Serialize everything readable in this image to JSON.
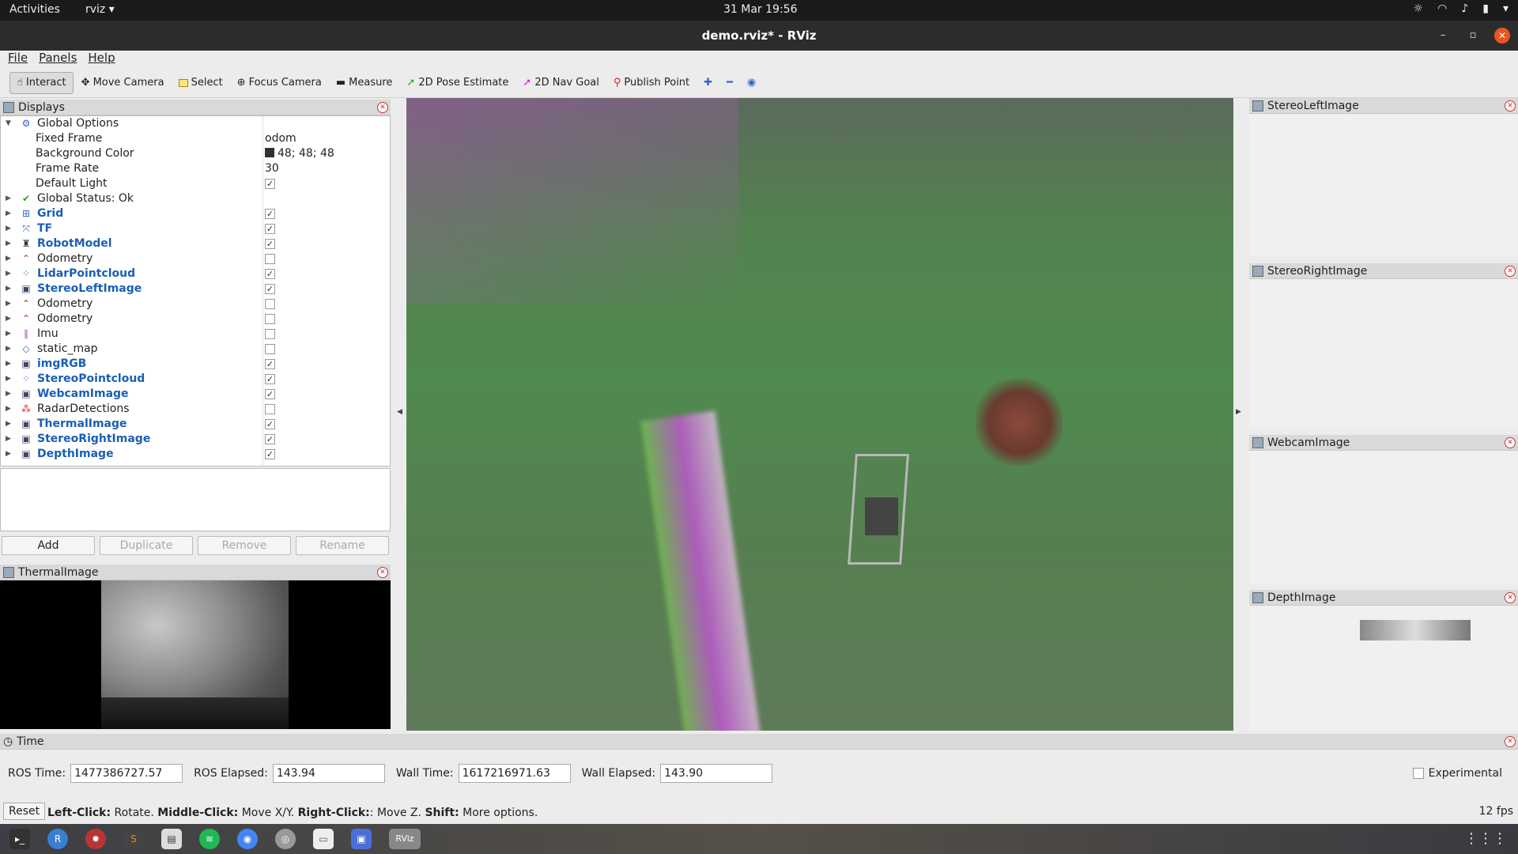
{
  "topbar": {
    "activities": "Activities",
    "app": "rviz",
    "app_arrow": "▾",
    "clock": "31 Mar  19:56"
  },
  "window": {
    "title": "demo.rviz* - RViz"
  },
  "menu": [
    "File",
    "Panels",
    "Help"
  ],
  "toolbar": [
    {
      "label": "Interact",
      "icon": "hand-icon",
      "active": true
    },
    {
      "label": "Move Camera",
      "icon": "move-icon"
    },
    {
      "label": "Select",
      "icon": "select-icon"
    },
    {
      "label": "Focus Camera",
      "icon": "focus-icon"
    },
    {
      "label": "Measure",
      "icon": "ruler-icon"
    },
    {
      "label": "2D Pose Estimate",
      "icon": "pose-arrow-icon"
    },
    {
      "label": "2D Nav Goal",
      "icon": "nav-arrow-icon"
    },
    {
      "label": "Publish Point",
      "icon": "pin-icon"
    }
  ],
  "displays": {
    "title": "Displays",
    "global_options": "Global Options",
    "props": [
      {
        "label": "Fixed Frame",
        "value": "odom"
      },
      {
        "label": "Background Color",
        "value": "48; 48; 48"
      },
      {
        "label": "Frame Rate",
        "value": "30"
      },
      {
        "label": "Default Light",
        "checked": true
      }
    ],
    "global_status": "Global Status: Ok",
    "items": [
      {
        "label": "Grid",
        "checked": true,
        "bold": true
      },
      {
        "label": "TF",
        "checked": true,
        "bold": true
      },
      {
        "label": "RobotModel",
        "checked": true,
        "bold": true
      },
      {
        "label": "Odometry",
        "checked": false,
        "bold": false
      },
      {
        "label": "LidarPointcloud",
        "checked": true,
        "bold": true
      },
      {
        "label": "StereoLeftImage",
        "checked": true,
        "bold": true
      },
      {
        "label": "Odometry",
        "checked": false,
        "bold": false
      },
      {
        "label": "Odometry",
        "checked": false,
        "bold": false
      },
      {
        "label": "Imu",
        "checked": false,
        "bold": false
      },
      {
        "label": "static_map",
        "checked": false,
        "bold": false
      },
      {
        "label": "imgRGB",
        "checked": true,
        "bold": true
      },
      {
        "label": "StereoPointcloud",
        "checked": true,
        "bold": true
      },
      {
        "label": "WebcamImage",
        "checked": true,
        "bold": true
      },
      {
        "label": "RadarDetections",
        "checked": false,
        "bold": false
      },
      {
        "label": "ThermalImage",
        "checked": true,
        "bold": true
      },
      {
        "label": "StereoRightImage",
        "checked": true,
        "bold": true
      },
      {
        "label": "DepthImage",
        "checked": true,
        "bold": true
      }
    ],
    "buttons": {
      "add": "Add",
      "duplicate": "Duplicate",
      "remove": "Remove",
      "rename": "Rename"
    }
  },
  "thermal_panel": "ThermalImage",
  "right_panels": [
    "StereoLeftImage",
    "StereoRightImage",
    "WebcamImage",
    "DepthImage"
  ],
  "time": {
    "title": "Time",
    "ros_time_label": "ROS Time:",
    "ros_time": "1477386727.57",
    "ros_elapsed_label": "ROS Elapsed:",
    "ros_elapsed": "143.94",
    "wall_time_label": "Wall Time:",
    "wall_time": "1617216971.63",
    "wall_elapsed_label": "Wall Elapsed:",
    "wall_elapsed": "143.90",
    "experimental": "Experimental"
  },
  "status": {
    "reset": "Reset",
    "left_click": "Left-Click:",
    "left_action": " Rotate. ",
    "middle_click": "Middle-Click:",
    "middle_action": " Move X/Y. ",
    "right_click": "Right-Click:",
    "right_action": ": Move Z. ",
    "shift": "Shift:",
    "shift_action": " More options.",
    "fps": "12 fps"
  },
  "dock": [
    "terminal-icon",
    "r-icon",
    "settings-icon",
    "sublime-icon",
    "notes-icon",
    "spotify-icon",
    "chrome-icon",
    "disk-icon",
    "files-icon",
    "screenshot-icon",
    "rviz-icon"
  ],
  "dock_rviz_label": "RViz"
}
